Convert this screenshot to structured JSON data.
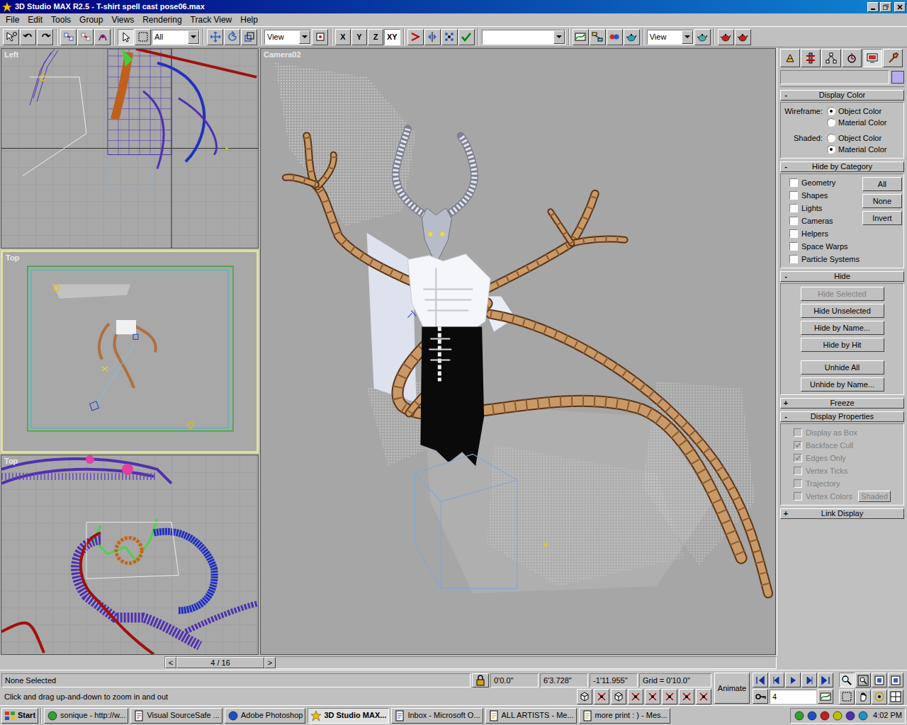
{
  "window": {
    "title": "3D Studio MAX R2.5 - T-shirt spell cast pose06.max"
  },
  "menu": [
    "File",
    "Edit",
    "Tools",
    "Group",
    "Views",
    "Rendering",
    "Track View",
    "Help"
  ],
  "toolbar": {
    "selection_filter": "All",
    "reference_coord": "View",
    "axes": [
      {
        "label": "X",
        "selected": false
      },
      {
        "label": "Y",
        "selected": false
      },
      {
        "label": "Z",
        "selected": false
      },
      {
        "label": "XY",
        "selected": true
      }
    ],
    "named_selection": "",
    "render_type": "View"
  },
  "viewports": [
    {
      "label": "Left",
      "active": false
    },
    {
      "label": "Top",
      "active": true
    },
    {
      "label": "Top",
      "active": false
    }
  ],
  "camera_viewport": {
    "label": "Camera02",
    "active": false
  },
  "command_panel": {
    "tabs": [
      {
        "selected": false
      },
      {
        "selected": false
      },
      {
        "selected": false
      },
      {
        "selected": false
      },
      {
        "selected": true
      },
      {
        "selected": false
      }
    ],
    "name": "",
    "display_color": {
      "sign": "-",
      "title": "Display Color",
      "groups": [
        {
          "label": "Wireframe:",
          "options": [
            {
              "label": "Object Color",
              "selected": true
            },
            {
              "label": "Material Color",
              "selected": false
            }
          ]
        },
        {
          "label": "Shaded:",
          "options": [
            {
              "label": "Object Color",
              "selected": false
            },
            {
              "label": "Material Color",
              "selected": true
            }
          ]
        }
      ]
    },
    "hide_by_category": {
      "sign": "-",
      "title": "Hide by Category",
      "categories": [
        {
          "label": "Geometry",
          "checked": false
        },
        {
          "label": "Shapes",
          "checked": false
        },
        {
          "label": "Lights",
          "checked": false
        },
        {
          "label": "Cameras",
          "checked": false
        },
        {
          "label": "Helpers",
          "checked": false
        },
        {
          "label": "Space Warps",
          "checked": false
        },
        {
          "label": "Particle Systems",
          "checked": false
        }
      ],
      "buttons": [
        "All",
        "None",
        "Invert"
      ]
    },
    "hide": {
      "sign": "-",
      "title": "Hide",
      "buttons": [
        {
          "label": "Hide Selected",
          "disabled": true
        },
        {
          "label": "Hide Unselected",
          "disabled": false
        },
        {
          "label": "Hide by Name...",
          "disabled": false
        },
        {
          "label": "Hide by Hit",
          "disabled": false
        },
        {
          "label": "Unhide All",
          "disabled": false
        },
        {
          "label": "Unhide by Name...",
          "disabled": false
        }
      ]
    },
    "freeze": {
      "sign": "+",
      "title": "Freeze"
    },
    "display_properties": {
      "sign": "-",
      "title": "Display Properties",
      "items": [
        {
          "label": "Display as Box",
          "checked": false,
          "disabled": true
        },
        {
          "label": "Backface Cull",
          "checked": true,
          "disabled": true
        },
        {
          "label": "Edges Only",
          "checked": true,
          "disabled": true
        },
        {
          "label": "Vertex Ticks",
          "checked": false,
          "disabled": true
        },
        {
          "label": "Trajectory",
          "checked": false,
          "disabled": true
        },
        {
          "label": "Vertex Colors",
          "checked": false,
          "disabled": true
        }
      ],
      "shaded_button": {
        "label": "Shaded",
        "disabled": true
      }
    },
    "link_display": {
      "sign": "+",
      "title": "Link Display"
    }
  },
  "time_slider": {
    "prev": "<",
    "label": "4 / 16",
    "next": ">"
  },
  "status": {
    "selection": "None Selected",
    "coords": [
      "0'0.0\"",
      "6'3.728\"",
      "-1'11.955\""
    ],
    "grid": "Grid = 0'10.0\"",
    "animate": "Animate",
    "frame": "4",
    "prompt": "Click and drag up-and-down to zoom in and out"
  },
  "taskbar": {
    "start": "Start",
    "items": [
      {
        "label": "sonique - http://w...",
        "selected": false
      },
      {
        "label": "Visual SourceSafe ...",
        "selected": false
      },
      {
        "label": "Adobe Photoshop",
        "selected": false
      },
      {
        "label": "3D Studio MAX...",
        "selected": true
      },
      {
        "label": "Inbox - Microsoft O...",
        "selected": false
      },
      {
        "label": "ALL ARTISTS - Me...",
        "selected": false
      },
      {
        "label": "more print : ) - Mes...",
        "selected": false
      }
    ],
    "clock": "4:02 PM"
  }
}
